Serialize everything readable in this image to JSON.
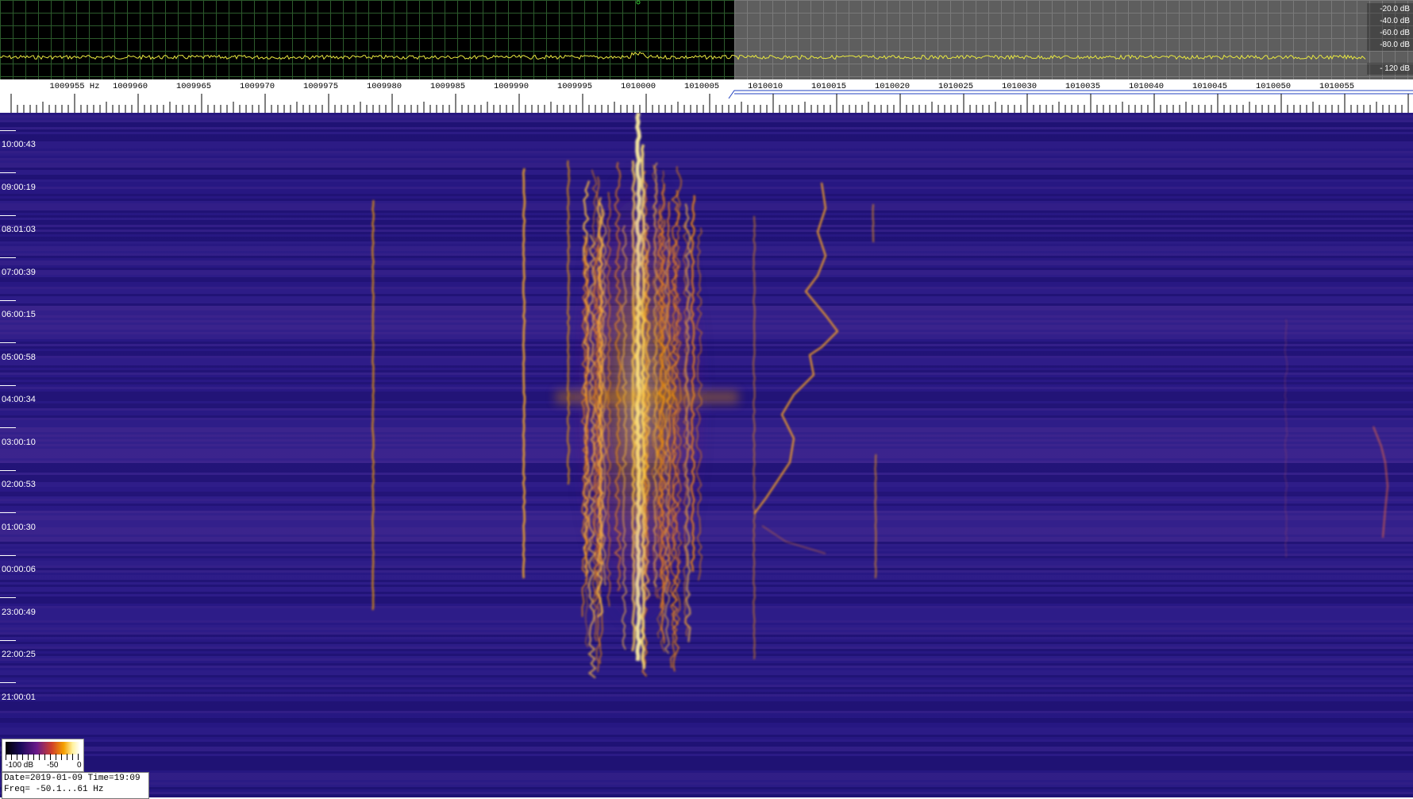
{
  "spectrum": {
    "db_labels": [
      "-20.0 dB",
      "-40.0 dB",
      "-60.0 dB",
      "-80.0 dB",
      "",
      "- 120 dB"
    ]
  },
  "ruler": {
    "freq_labels": [
      "1009955 Hz",
      "1009960",
      "1009965",
      "1009970",
      "1009975",
      "1009980",
      "1009985",
      "1009990",
      "1009995",
      "1010000",
      "1010005",
      "1010010",
      "1010015",
      "1010020",
      "1010025",
      "1010030",
      "1010035",
      "1010040",
      "1010045",
      "1010050",
      "1010055"
    ]
  },
  "waterfall": {
    "time_labels": [
      "10:00:43",
      "09:00:19",
      "08:01:03",
      "07:00:39",
      "06:00:15",
      "05:00:58",
      "04:00:34",
      "03:00:10",
      "02:00:53",
      "01:00:30",
      "00:00:06",
      "23:00:49",
      "22:00:25",
      "21:00:01"
    ]
  },
  "legend": {
    "min_label": "-100 dB",
    "mid_label": "-50",
    "max_label": "0"
  },
  "info": {
    "line1": "Date=2019-01-09 Time=19:09",
    "line2": "Freq= -50.1...61 Hz"
  },
  "colors": {
    "background": "#25177a",
    "signal_core": "#ffe070",
    "signal_mid": "#f5a000",
    "spectrum_trace": "#e8e840"
  }
}
